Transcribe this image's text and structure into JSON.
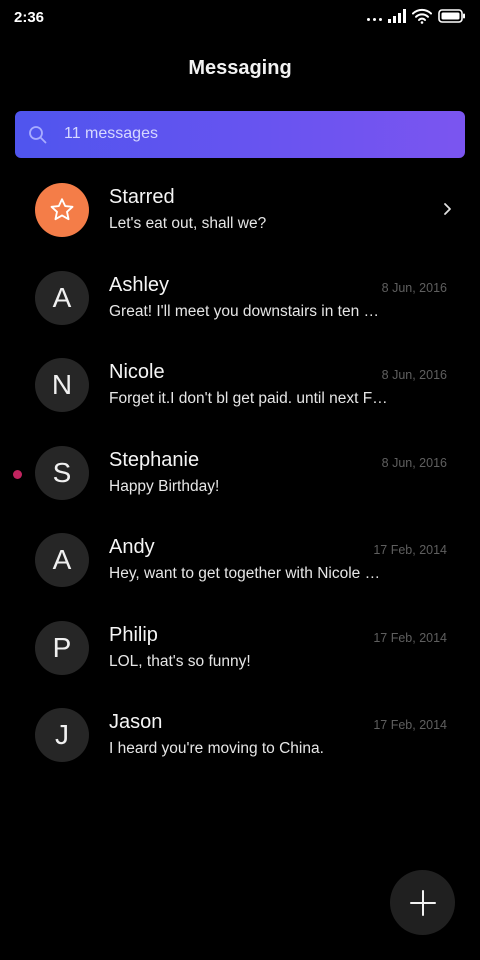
{
  "status_bar": {
    "time": "2:36",
    "icons": [
      "more-dots-icon",
      "signal-icon",
      "wifi-icon",
      "battery-icon"
    ]
  },
  "header": {
    "title": "Messaging"
  },
  "search": {
    "text": "11 messages",
    "icon": "search-icon",
    "gradient_start": "#4f55ee",
    "gradient_end": "#7b55f0"
  },
  "colors": {
    "starred_avatar": "#f47d48",
    "avatar_bg": "#262626",
    "unread_dot": "#c1245f",
    "date_text": "#5f5f5f"
  },
  "conversations": [
    {
      "initial": "",
      "name": "Starred",
      "preview": "Let's eat out, shall we?",
      "date": "",
      "starred": true,
      "unread": false
    },
    {
      "initial": "A",
      "name": "Ashley",
      "preview": "Great! I'll meet you downstairs in ten …",
      "date": "8 Jun, 2016",
      "starred": false,
      "unread": false
    },
    {
      "initial": "N",
      "name": "Nicole",
      "preview": "Forget it.I don't bl get paid. until next F…",
      "date": "8 Jun, 2016",
      "starred": false,
      "unread": false
    },
    {
      "initial": "S",
      "name": "Stephanie",
      "preview": "Happy Birthday!",
      "date": "8 Jun, 2016",
      "starred": false,
      "unread": true
    },
    {
      "initial": "A",
      "name": "Andy",
      "preview": "Hey, want to get together with Nicole …",
      "date": "17 Feb, 2014",
      "starred": false,
      "unread": false
    },
    {
      "initial": "P",
      "name": "Philip",
      "preview": "LOL, that's so funny!",
      "date": "17 Feb, 2014",
      "starred": false,
      "unread": false
    },
    {
      "initial": "J",
      "name": "Jason",
      "preview": "I heard you're moving to China.",
      "date": "17 Feb, 2014",
      "starred": false,
      "unread": false
    }
  ],
  "fab": {
    "icon": "plus-icon"
  }
}
